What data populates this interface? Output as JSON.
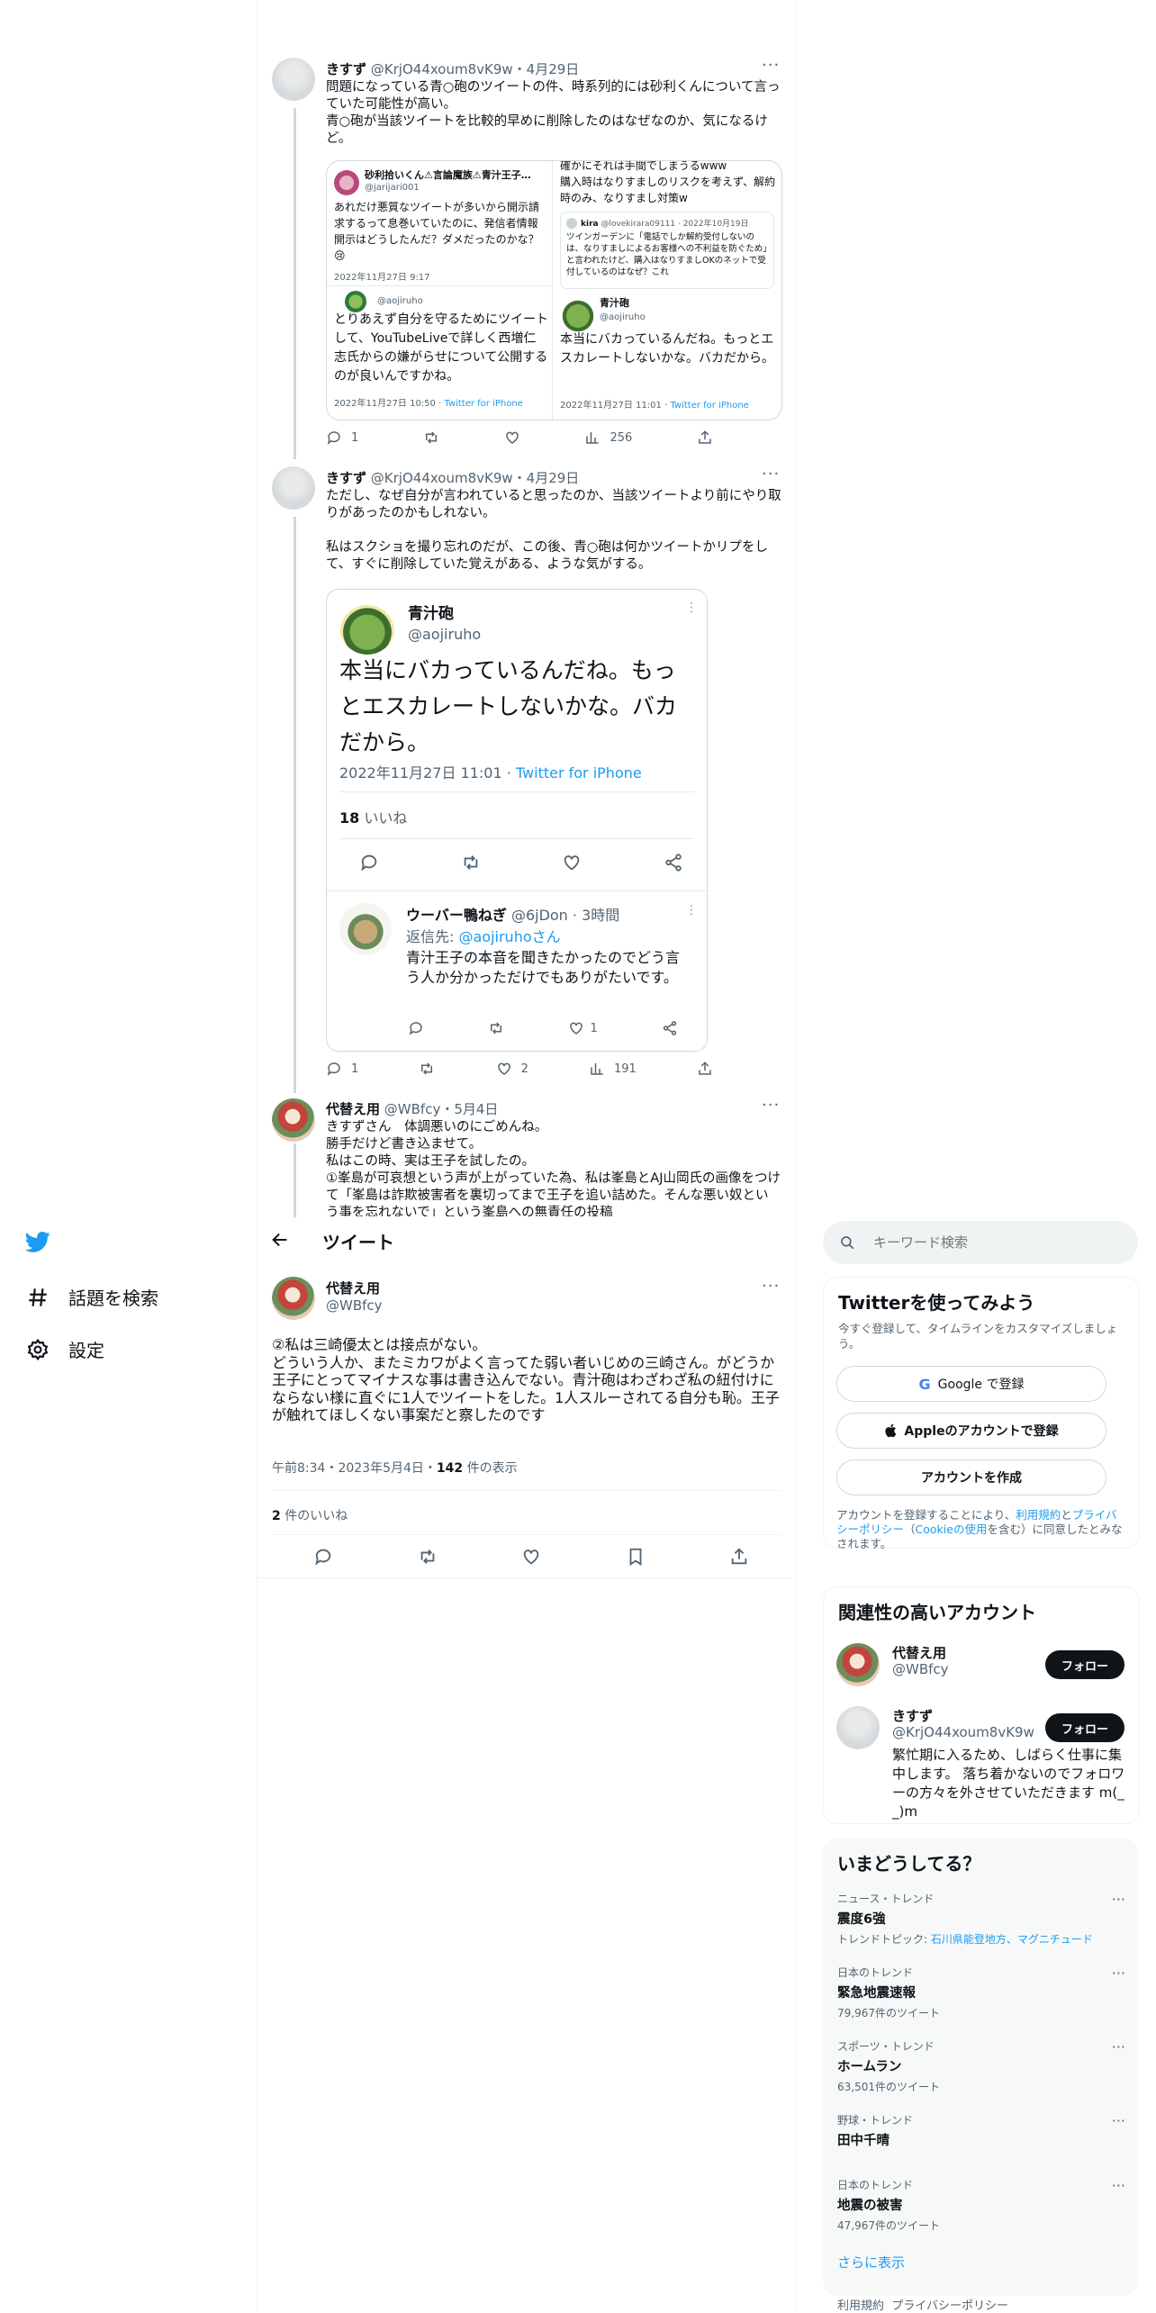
{
  "colors": {
    "accent": "#1d9bf0",
    "text": "#0f1419",
    "muted": "#536471",
    "border": "#cfd9de",
    "panel": "#f7f9f9"
  },
  "nav": {
    "items": [
      {
        "icon": "twitter-bird-icon",
        "label": ""
      },
      {
        "icon": "hashtag-icon",
        "label": "話題を検索"
      },
      {
        "icon": "gear-icon",
        "label": "設定"
      }
    ]
  },
  "thread": {
    "tweet1": {
      "name": "きすず",
      "handle": "@KrjO44xoum8vK9w",
      "date": "・4月29日",
      "text": "問題になっている青○砲のツイートの件、時系列的には砂利くんについて言っていた可能性が高い。\n青○砲が当該ツイートを比較的早めに削除したのはなぜなのか、気になるけど。",
      "image": {
        "left_name": "砂利拾いくん⚠言論魔族⚠青汁王子…",
        "left_handle": "@jarijari001",
        "left_text": "あれだけ悪質なツイートが多いから開示請求するって息巻いていたのに、発信者情報開示はどうしたんだ？ダメだったのかな？😢",
        "left_date": "2022年11月27日 9:17",
        "left_reply_handle": "@aojiruho",
        "left_reply_text": "とりあえず自分を守るためにツイートして、YouTubeLiveで詳しく西増仁志氏からの嫌がらせについて公開するのが良いんですかね。",
        "left_reply_date": "2022年11月27日 10:50",
        "left_reply_source": "Twitter for iPhone",
        "right_top_text": "確かにそれは手間でしまうるwww\n購入時はなりすましのリスクを考えず、解約時のみ、なりすまし対策w",
        "right_quote_name": "kira",
        "right_quote_handle": "@lovekirara09111 · 2022年10月19日",
        "right_quote_text": "ツインガーデンに「電話でしか解約受付しないのは、なりすましによるお客様への不利益を防ぐため」と言われたけど、購入はなりすましOKのネットで受付しているのはなぜ？これ",
        "right_name": "青汁砲",
        "right_handle": "@aojiruho",
        "right_text": "本当にバカっているんだね。もっとエスカレートしないかな。バカだから。",
        "right_date": "2022年11月27日 11:01",
        "right_source": "Twitter for iPhone"
      },
      "stats": {
        "replies": "1",
        "retweets": "",
        "likes": "",
        "views": "256"
      }
    },
    "tweet2": {
      "name": "きすず",
      "handle": "@KrjO44xoum8vK9w",
      "date": "・4月29日",
      "text": "ただし、なぜ自分が言われていると思ったのか、当該ツイートより前にやり取りがあったのかもしれない。\n\n私はスクショを撮り忘れのだが、この後、青○砲は何かツイートかリプをして、すぐに削除していた覚えがある、ような気がする。",
      "image": {
        "name": "青汁砲",
        "handle": "@aojiruho",
        "text": "本当にバカっているんだね。もっとエスカレートしないかな。バカだから。",
        "date": "2022年11月27日 11:01",
        "source": "Twitter for iPhone",
        "likes_count": "18",
        "likes_label": "いいね",
        "reply_name": "ウーバー鴨ねぎ",
        "reply_handle": "@6jDon",
        "reply_time": "· 3時間",
        "reply_to_label": "返信先: ",
        "reply_to_handle": "@aojiruhoさん",
        "reply_text": "青汁王子の本音を聞きたかったのでどう言う人か分かっただけでもありがたいです。",
        "reply_likes": "1"
      },
      "stats": {
        "replies": "1",
        "retweets": "",
        "likes": "2",
        "views": "191"
      }
    },
    "tweet3": {
      "name": "代替え用",
      "handle": "@WBfcy",
      "date": "・5月4日",
      "text": "きすずさん　体調悪いのにごめんね。\n勝手だけど書き込ませて。\n私はこの時、実は王子を試したの。\n①峯島が可哀想という声が上がっていた為、私は峯島とAJ山岡氏の画像をつけて「峯島は詐欺被害者を裏切ってまで王子を追い詰めた。そんな悪い奴という事を忘れないで」という峯島への無責任の投稿"
    }
  },
  "main": {
    "header_title": "ツイート",
    "author_name": "代替え用",
    "author_handle": "@WBfcy",
    "text": "②私は三崎優太とは接点がない。\nどういう人か、またミカワがよく言ってた弱い者いじめの三崎さん。がどうか\n王子にとってマイナスな事は書き込んでない。青汁砲はわざわざ私の紐付けにならない様に直ぐに1人でツイートをした。1人スルーされてる自分も恥。王子が触れてほしくない事案だと察したのです",
    "time": "午前8:34・2023年5月4日・",
    "views_count": "142",
    "views_label": " 件の表示",
    "likes_count": "2",
    "likes_label": " 件のいいね"
  },
  "sidebar": {
    "search_placeholder": "キーワード検索",
    "signup": {
      "title": "Twitterを使ってみよう",
      "subtitle": "今すぐ登録して、タイムラインをカスタマイズしましょう。",
      "google": "Google で登録",
      "apple": "Appleのアカウントで登録",
      "create": "アカウントを作成",
      "terms_prefix": "アカウントを登録することにより、",
      "terms_link": "利用規約",
      "terms_and": "と",
      "privacy_link": "プライバシーポリシー",
      "cookie_prefix": "（",
      "cookie_link": "Cookieの使用",
      "terms_suffix": "を含む）に同意したとみなされます。"
    },
    "related": {
      "title": "関連性の高いアカウント",
      "accounts": [
        {
          "name": "代替え用",
          "handle": "@WBfcy",
          "bio": "",
          "follow": "フォロー"
        },
        {
          "name": "きすず",
          "handle": "@KrjO44xoum8vK9w",
          "bio": "繁忙期に入るため、しばらく仕事に集中します。 落ち着かないのでフォロワーの方々を外させていただきます m(_ _)m",
          "follow": "フォロー"
        }
      ]
    },
    "trends": {
      "title": "いまどうしてる？",
      "items": [
        {
          "category": "ニュース・トレンド",
          "name": "震度6強",
          "extra_prefix": "トレンドトピック: ",
          "extra_link": "石川県能登地方、マグニチュード",
          "count": ""
        },
        {
          "category": "日本のトレンド",
          "name": "緊急地震速報",
          "extra_prefix": "",
          "extra_link": "",
          "count": "79,967件のツイート"
        },
        {
          "category": "スポーツ・トレンド",
          "name": "ホームラン",
          "extra_prefix": "",
          "extra_link": "",
          "count": "63,501件のツイート"
        },
        {
          "category": "野球・トレンド",
          "name": "田中千晴",
          "extra_prefix": "",
          "extra_link": "",
          "count": ""
        },
        {
          "category": "日本のトレンド",
          "name": "地震の被害",
          "extra_prefix": "",
          "extra_link": "",
          "count": "47,967件のツイート"
        }
      ],
      "show_more": "さらに表示"
    },
    "footer": {
      "terms": "利用規約",
      "privacy": "プライバシーポリシー"
    }
  }
}
